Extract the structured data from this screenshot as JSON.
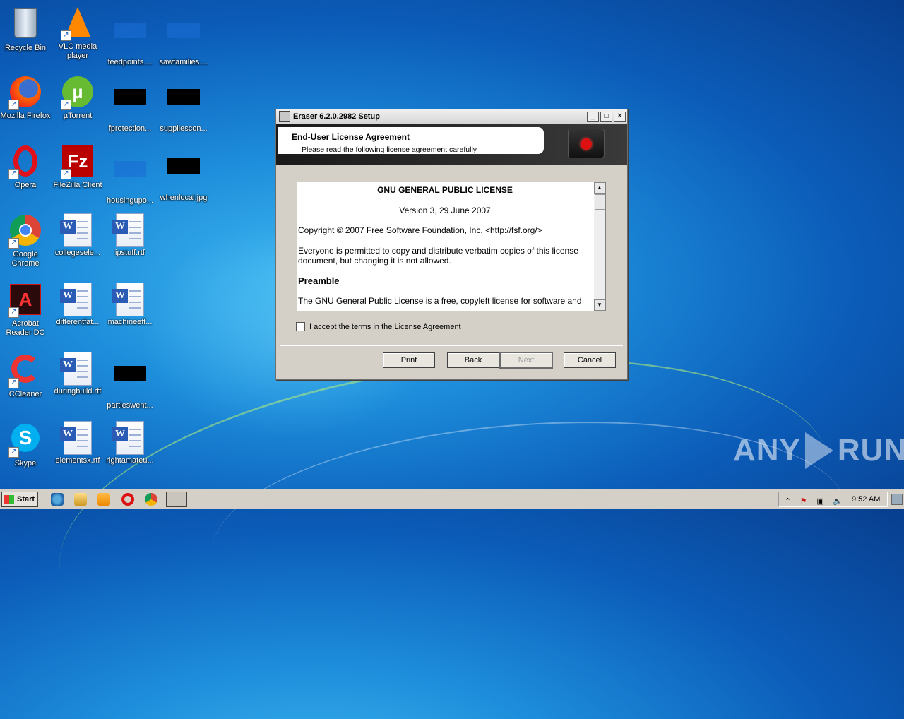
{
  "desktop": {
    "icons": [
      {
        "label": "Recycle Bin"
      },
      {
        "label": "VLC media player"
      },
      {
        "label": "feedpoints...."
      },
      {
        "label": "sawfamilies...."
      },
      {
        "label": "Mozilla Firefox"
      },
      {
        "label": "µTorrent"
      },
      {
        "label": "fprotection..."
      },
      {
        "label": "suppliescon..."
      },
      {
        "label": "Opera"
      },
      {
        "label": "FileZilla Client"
      },
      {
        "label": "housingupo..."
      },
      {
        "label": "whenlocal.jpg"
      },
      {
        "label": "Google Chrome"
      },
      {
        "label": "collegesele..."
      },
      {
        "label": "ipstuff.rtf"
      },
      {
        "label": "Acrobat Reader DC"
      },
      {
        "label": "differentfat..."
      },
      {
        "label": "machineeff..."
      },
      {
        "label": "CCleaner"
      },
      {
        "label": "duringbuild.rtf"
      },
      {
        "label": "partieswent..."
      },
      {
        "label": "Skype"
      },
      {
        "label": "elementsx.rtf"
      },
      {
        "label": "rightamateu..."
      }
    ]
  },
  "dialog": {
    "title": "Eraser 6.2.0.2982 Setup",
    "banner_title": "End-User License Agreement",
    "banner_subtitle": "Please read the following license agreement carefully",
    "license": {
      "heading": "GNU GENERAL PUBLIC LICENSE",
      "version": "Version 3, 29 June 2007",
      "copyright": "Copyright © 2007 Free Software Foundation, Inc. <http://fsf.org/>",
      "permission": "Everyone is permitted to copy and distribute verbatim copies of this license document, but changing it is not allowed.",
      "preamble": "Preamble",
      "body": "The GNU General Public License is a free, copyleft license for software and"
    },
    "accept_label": "I accept the terms in the License Agreement",
    "buttons": {
      "print": "Print",
      "back": "Back",
      "next": "Next",
      "cancel": "Cancel"
    }
  },
  "taskbar": {
    "start_label": "Start",
    "clock": "9:52 AM"
  },
  "watermark": {
    "left": "ANY",
    "right": "RUN"
  }
}
